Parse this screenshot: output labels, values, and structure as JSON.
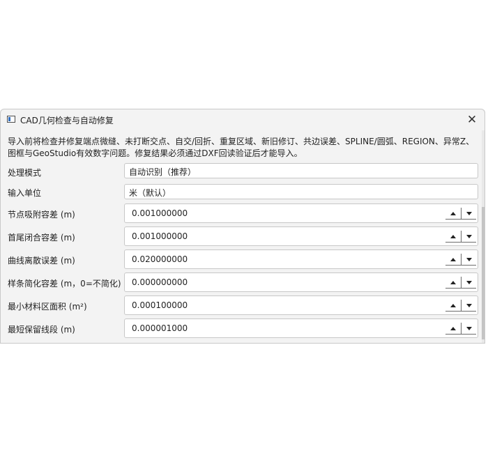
{
  "window": {
    "title": "CAD几何检查与自动修复",
    "close_glyph": "✕"
  },
  "description": "导入前将检查并修复端点微缝、未打断交点、自交/回折、重复区域、新旧修订、共边误差、SPLINE/圆弧、REGION、异常Z、图框与GeoStudio有效数字问题。修复结果必须通过DXF回读验证后才能导入。",
  "fields": [
    {
      "label": "处理模式",
      "value": "自动识别（推荐）",
      "kind": "combo"
    },
    {
      "label": "输入单位",
      "value": "米（默认）",
      "kind": "combo"
    },
    {
      "label": "节点吸附容差 (m)",
      "value": "0.001000000",
      "kind": "spin"
    },
    {
      "label": "首尾闭合容差 (m)",
      "value": "0.001000000",
      "kind": "spin"
    },
    {
      "label": "曲线离散误差 (m)",
      "value": "0.020000000",
      "kind": "spin"
    },
    {
      "label": "样条简化容差 (m，0=不简化)",
      "value": "0.000000000",
      "kind": "spin"
    },
    {
      "label": "最小材料区面积 (m²)",
      "value": "0.000100000",
      "kind": "spin"
    },
    {
      "label": "最短保留线段 (m)",
      "value": "0.000001000",
      "kind": "spin"
    }
  ],
  "spin_icons": {
    "up": "triangle-up-icon",
    "down": "triangle-down-icon"
  }
}
